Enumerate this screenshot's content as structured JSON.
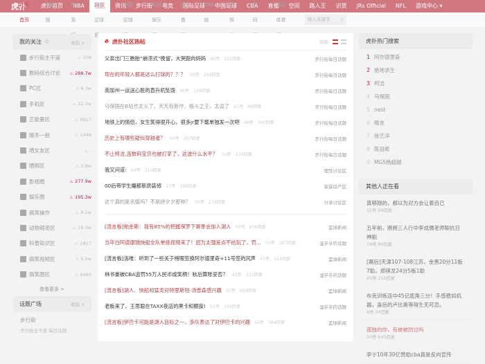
{
  "nav": {
    "logo": "虎扑",
    "items": [
      "虎扑首页",
      "NBA",
      "社区",
      "资讯",
      "步行街",
      "电竞",
      "国际足球",
      "中国足球",
      "CBA",
      "直播",
      "空间",
      "路人王",
      "识货",
      "JRs Official",
      "NFL",
      "游戏中心 ▾"
    ],
    "active": 2
  },
  "subnav": {
    "items": [
      "社区首页",
      "NBA版",
      "电竞版",
      "国际足球版",
      "中国足球版",
      "影视娱乐版",
      "装备版",
      "CBA版",
      "晒照片",
      "数码版",
      "综合体育版"
    ],
    "search_placeholder": "输入关键字"
  },
  "left": {
    "follow_title": "我的关注",
    "collapse": "收起 ∨",
    "items": [
      {
        "name": "步行街主干道",
        "count": "106",
        "hot": false
      },
      {
        "name": "数码综合讨论",
        "count": "288.7w",
        "hot": true
      },
      {
        "name": "PC区",
        "count": "9.7w",
        "hot": false
      },
      {
        "name": "手机区",
        "count": "22.3w",
        "hot": false
      },
      {
        "name": "正能量区",
        "count": "9917",
        "hot": false
      },
      {
        "name": "随手一拍",
        "count": "1446",
        "hot": false
      },
      {
        "name": "晒女友区",
        "count": "-",
        "hot": false
      },
      {
        "name": "晒照区",
        "count": "3.9w",
        "hot": false
      },
      {
        "name": "影视圈",
        "count": "277.9w",
        "hot": true
      },
      {
        "name": "娱乐圈",
        "count": "195.3w",
        "hot": true
      },
      {
        "name": "搞笑操作",
        "count": "8.1w",
        "hot": false
      },
      {
        "name": "动物萌宠区",
        "count": "19.3w",
        "hot": false
      },
      {
        "name": "科普知识区",
        "count": "2817",
        "hot": false
      },
      {
        "name": "搞笑视频区",
        "count": "5.5w",
        "hot": false
      },
      {
        "name": "搞笑图区",
        "count": "6480",
        "hot": false
      }
    ],
    "more": "查看更多 >",
    "topic_title": "话题广场",
    "topic_collapse": "收起 ∨",
    "topic_item": "步行街",
    "topic_sub": "步行街主干道   每日话题"
  },
  "center": {
    "title": "虎扑社区热帖",
    "view_label": "视图:",
    "posts": [
      {
        "t": "父亲出门三胞胎“崩溃式”挽留，大哭跑向妈妈",
        "l": "40亮",
        "r": "115回复",
        "tag": "步行街每日话题",
        "c": "#333"
      },
      {
        "t": "现在的年轻人都是这么打球的？？？",
        "l": "50亮",
        "r": "269回复",
        "tag": "步行街每日话题",
        "c": "#b4454a"
      },
      {
        "t": "南加州一运送心脏的直升机坠毁",
        "l": "46亮",
        "r": "139回复",
        "tag": "步行街每日话题",
        "c": "#333"
      },
      {
        "t": "马保国在B站也太火了，天天有新作，格斗之王，太逗了",
        "l": "25亮",
        "r": "99回复",
        "tag": "步行街每日话题",
        "c": "#999"
      },
      {
        "t": "地铁上的情侣，女生笑得很开心，很多jr要下载单独发一次吧",
        "l": "36亮",
        "r": "160回复",
        "tag": "步行街每日话题",
        "c": "#333"
      },
      {
        "t": "历史上有哪些疑似穿越者？",
        "l": "50亮",
        "r": "357回复",
        "tag": "步行街每日话题",
        "c": "#b4454a"
      },
      {
        "t": "不止柯洁,连数码宝贝也被打挛了，这波什么水平？",
        "l": "50亮",
        "r": "279回复",
        "tag": "步行街每日话题",
        "c": "#b4454a"
      },
      {
        "t": "我又问道:",
        "l": "43亮",
        "r": "210回复",
        "tag": "理性讨论区",
        "c": "#333"
      },
      {
        "t": "00后带学生魔都新房装修",
        "l": "27亮",
        "r": "199回复",
        "tag": "家装房产区",
        "c": "#333"
      },
      {
        "t": "这个真的是名媛吗？不是拼夕夕那种？",
        "l": "50亮",
        "r": "216回复",
        "tag": "分享讨论区",
        "c": "#999"
      }
    ],
    "posts2": [
      {
        "t": "[流言板]帕金斯：我有85%的把握保罗下赛季会加入湖人",
        "l": "50亮",
        "r": "856回复",
        "tag": "篮球新闻",
        "c": "#b4454a"
      },
      {
        "t": "当年白阿德康瑞快船全队单挑视频来了！因为太强差点不给玩了，罚...",
        "l": "50亮",
        "r": "307回复",
        "tag": "湿乎乎的话题",
        "c": "#b4454a"
      },
      {
        "t": "[流言板]洛唯：听到了一些关于榜眼签换阿尔德里奇+11号签的风声",
        "l": "47亮",
        "r": "222回复",
        "tag": "篮球新闻",
        "c": "#333"
      },
      {
        "t": "林书豪被CBA追罚55万人民币成笑柄！秋后算账妥否？",
        "l": "43亮",
        "r": "132回复",
        "tag": "湿乎乎的话题",
        "c": "#333"
      },
      {
        "t": "[流言板]湖人、快船和猛龙对特里斯坦-汤普森感兴趣",
        "l": "50亮",
        "r": "654回复",
        "tag": "篮球新闻",
        "c": "#b4454a"
      },
      {
        "t": "老板来了，王思聪在TAXX夜店的黑卡和额度!",
        "l": "50亮",
        "r": "159回复",
        "tag": "湿乎乎的话题",
        "c": "#333"
      },
      {
        "t": "[流言板]伊巴卡可能是湖人目标之一，多队表达了对伊巴卡的兴趣",
        "l": "50亮",
        "r": "364回复",
        "tag": "篮球新闻",
        "c": "#b4454a"
      }
    ]
  },
  "right": {
    "search_title": "虎扑热门搜索",
    "hot": [
      "阿尔德里奇",
      "绝地求生",
      "柯洁",
      "马保国",
      "nest",
      "喻言",
      "徐艺洋",
      "陈冠希",
      "MG5杨超越"
    ],
    "watch_title": "其他人正在看",
    "watch": [
      {
        "t": "真够刚的，都以为对方会让着自己",
        "m": "15亮 98回复",
        "c": "#777"
      },
      {
        "t": "五年前，將將三人行中李成儒老师聊抗日神剧",
        "m": "19亮 86回复",
        "c": "#777"
      },
      {
        "t": "[赛后]天津107-108江苏，金晋20分11板7助，郑祺龙24分5板1助",
        "m": "45亮 215回复",
        "c": "#777"
      },
      {
        "t": "布克训练连中45记底角三分！手感稳如机器，身后的卢比奥等得生无可恋。",
        "m": "8亮 34回复",
        "c": "#777"
      },
      {
        "t": "孤独的你，有被被防过吗",
        "m": "50亮 645回复",
        "c": "#d0777f"
      },
      {
        "t": "李宁10年30亿赞助cba真是反向宣传",
        "m": "",
        "c": "#777"
      }
    ]
  }
}
